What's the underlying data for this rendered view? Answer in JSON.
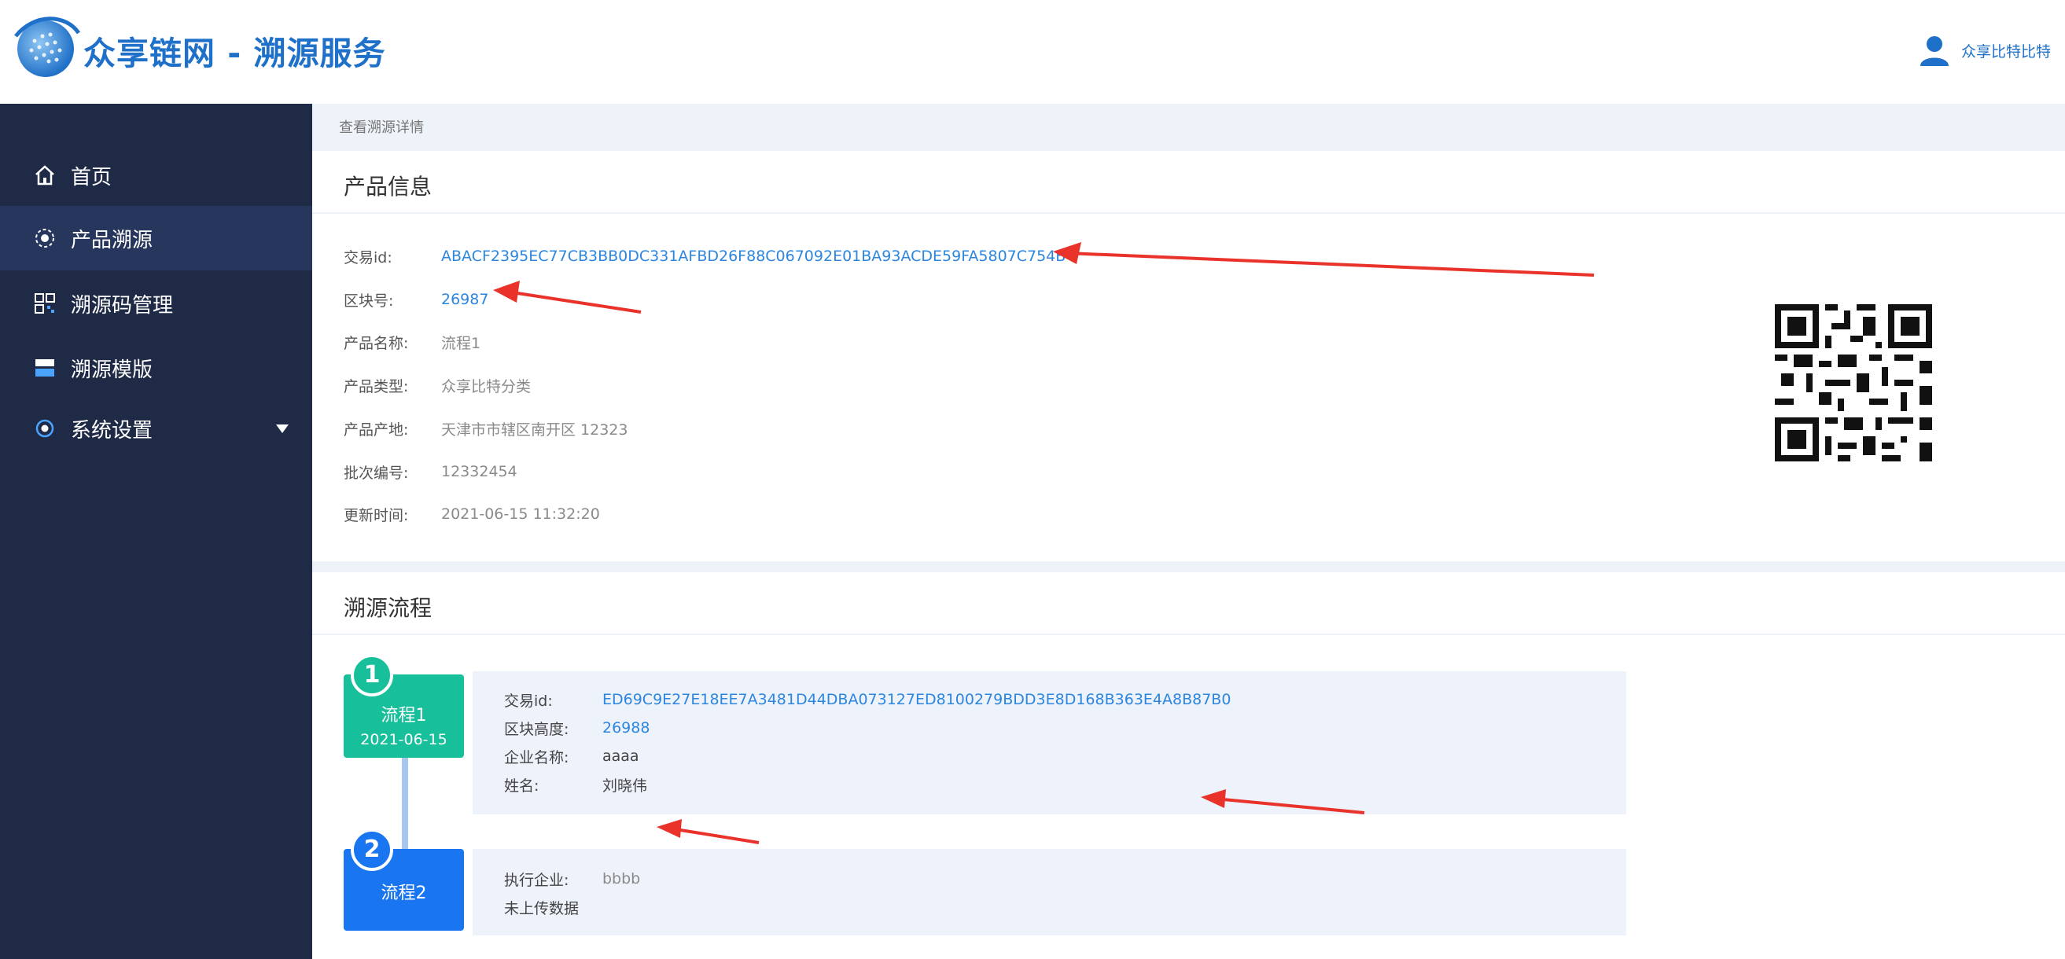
{
  "header": {
    "app_title": "众享链网 - 溯源服务",
    "user_name": "众享比特比特",
    "brand_color": "#1f70c8"
  },
  "sidebar": {
    "items": [
      {
        "label": "首页",
        "icon": "home-icon"
      },
      {
        "label": "产品溯源",
        "icon": "trace-icon",
        "active": true
      },
      {
        "label": "溯源码管理",
        "icon": "qr-grid-icon"
      },
      {
        "label": "溯源模版",
        "icon": "template-icon"
      },
      {
        "label": "系统设置",
        "icon": "settings-icon",
        "expandable": true
      }
    ],
    "background": "#1f2a46"
  },
  "breadcrumb": "查看溯源详情",
  "product_info": {
    "title": "产品信息",
    "rows": [
      {
        "label": "交易id:",
        "value": "ABACF2395EC77CB3BB0DC331AFBD26F88C067092E01BA93ACDE59FA5807C754B",
        "link": true
      },
      {
        "label": "区块号:",
        "value": "26987",
        "link": true
      },
      {
        "label": "产品名称:",
        "value": "流程1"
      },
      {
        "label": "产品类型:",
        "value": "众享比特分类"
      },
      {
        "label": "产品产地:",
        "value": "天津市市辖区南开区  12323"
      },
      {
        "label": "批次编号:",
        "value": "12332454"
      },
      {
        "label": "更新时间:",
        "value": "2021-06-15 11:32:20"
      }
    ]
  },
  "trace_flow": {
    "title": "溯源流程",
    "steps": [
      {
        "number": "1",
        "name": "流程1",
        "date": "2021-06-15",
        "color": "#17bf9a",
        "rows": [
          {
            "label": "交易id:",
            "value": "ED69C9E27E18EE7A3481D44DBA073127ED8100279BDD3E8D168B363E4A8B87B0",
            "link": true
          },
          {
            "label": "区块高度:",
            "value": "26988",
            "link": true
          },
          {
            "label": "企业名称:",
            "value": "aaaa"
          },
          {
            "label": "姓名:",
            "value": "刘晓伟"
          }
        ]
      },
      {
        "number": "2",
        "name": "流程2",
        "color": "#1976f0",
        "rows": [
          {
            "label": "执行企业:",
            "value": "bbbb",
            "grey": true
          },
          {
            "label": "未上传数据",
            "value": ""
          }
        ]
      }
    ]
  },
  "annotation_color": "#e8322a"
}
